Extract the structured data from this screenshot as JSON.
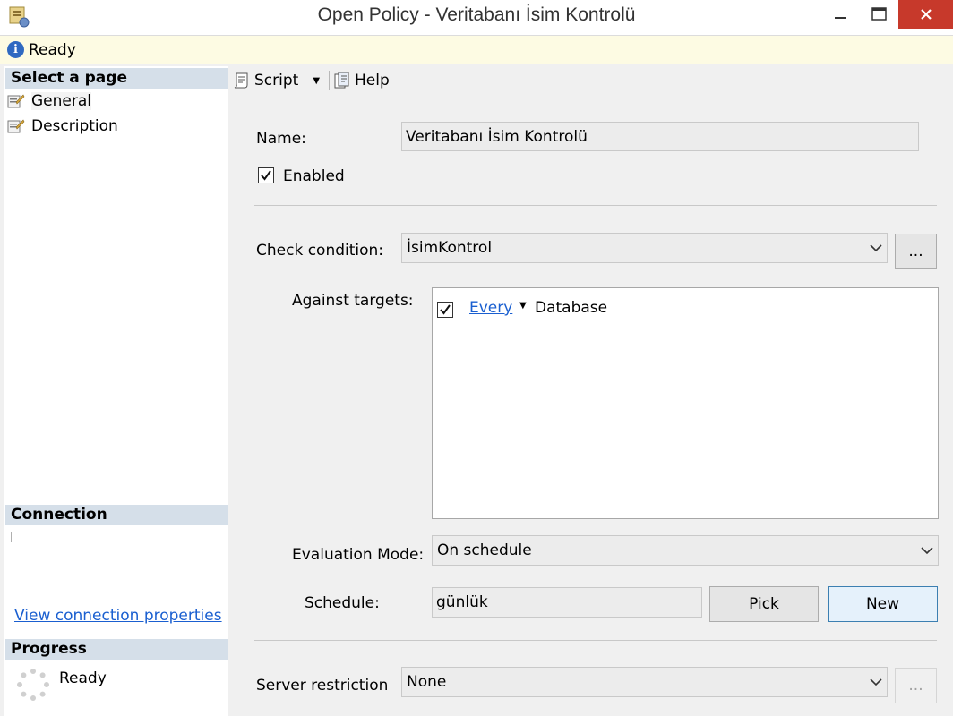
{
  "window": {
    "title": "Open Policy - Veritabanı İsim Kontrolü"
  },
  "status": {
    "text": "Ready"
  },
  "left": {
    "select_page_header": "Select a page",
    "pages": [
      {
        "label": "General"
      },
      {
        "label": "Description"
      }
    ],
    "connection_header": "Connection",
    "connection_link": "View connection properties",
    "progress_header": "Progress",
    "progress_text": "Ready"
  },
  "toolbar": {
    "script_label": "Script",
    "help_label": "Help"
  },
  "form": {
    "name_label": "Name:",
    "name_value": "Veritabanı İsim Kontrolü",
    "enabled_label": "Enabled",
    "enabled_checked": true,
    "check_condition_label": "Check condition:",
    "check_condition_value": "İsimKontrol",
    "browse_label": "...",
    "against_targets_label": "Against targets:",
    "target_every": "Every",
    "target_database": "Database",
    "evaluation_mode_label": "Evaluation Mode:",
    "evaluation_mode_value": "On schedule",
    "schedule_label": "Schedule:",
    "schedule_value": "günlük",
    "pick_label": "Pick",
    "new_label": "New",
    "server_restriction_label": "Server restriction",
    "server_restriction_value": "None",
    "server_browse_label": "..."
  },
  "colors": {
    "close_button": "#c7392b",
    "section_header": "#d5dfe9",
    "link": "#1a5fd0",
    "status_bar": "#fdfbe3"
  }
}
